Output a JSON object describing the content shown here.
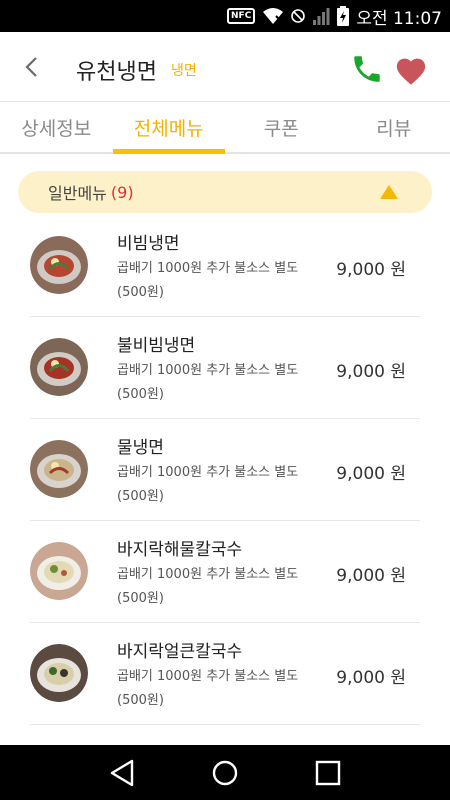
{
  "status_bar": {
    "nfc_label": "NFC",
    "time": "오전 11:07",
    "icons": [
      "nfc-icon",
      "wifi-off-icon",
      "mute-icon",
      "signal-icon",
      "battery-charging-icon"
    ]
  },
  "header": {
    "store_name": "유천냉면",
    "category": "냉면",
    "icons": [
      "back-arrow-icon",
      "phone-icon",
      "heart-icon"
    ]
  },
  "tabs": [
    {
      "label": "상세정보",
      "active": false
    },
    {
      "label": "전체메뉴",
      "active": true
    },
    {
      "label": "쿠폰",
      "active": false
    },
    {
      "label": "리뷰",
      "active": false
    }
  ],
  "section": {
    "title": "일반메뉴",
    "count": "(9)"
  },
  "menu_items": [
    {
      "name": "비빔냉면",
      "desc": "곱배기 1000원 추가 불소스 별도 (500원)",
      "price": "9,000 원"
    },
    {
      "name": "불비빔냉면",
      "desc": "곱배기 1000원 추가 불소스 별도 (500원)",
      "price": "9,000 원"
    },
    {
      "name": "물냉면",
      "desc": "곱배기 1000원 추가 불소스 별도 (500원)",
      "price": "9,000 원"
    },
    {
      "name": "바지락해물칼국수",
      "desc": "곱배기 1000원 추가 불소스 별도 (500원)",
      "price": "9,000 원"
    },
    {
      "name": "바지락얼큰칼국수",
      "desc": "곱배기 1000원 추가 불소스 별도 (500원)",
      "price": "9,000 원"
    }
  ],
  "colors": {
    "accent": "#f5c100",
    "section_bg": "#fdf1c9",
    "count_red": "#e53030",
    "phone_green": "#1aa52b",
    "heart_red": "#c9555a"
  }
}
